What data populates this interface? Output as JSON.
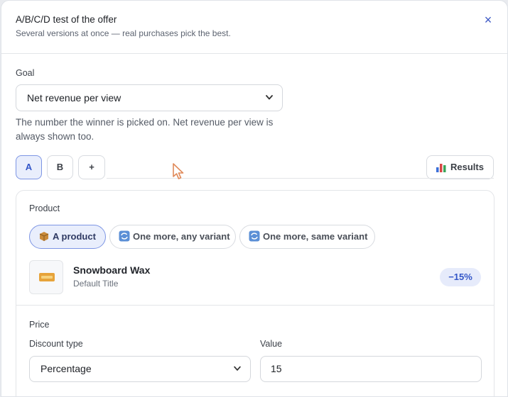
{
  "header": {
    "title": "A/B/C/D test of the offer",
    "subtitle": "Several versions at once — real purchases pick the best.",
    "close_glyph": "×"
  },
  "goal": {
    "label": "Goal",
    "selected": "Net revenue per view",
    "help": "The number the winner is picked on. Net revenue per view is always shown too."
  },
  "variants": {
    "tabs": [
      {
        "label": "A",
        "active": true
      },
      {
        "label": "B",
        "active": false
      },
      {
        "label": "+",
        "active": false
      }
    ],
    "results_label": "Results"
  },
  "product": {
    "section_label": "Product",
    "chips": [
      {
        "label": "A product",
        "icon": "package-icon",
        "active": true
      },
      {
        "label": "One more, any variant",
        "icon": "repeat-icon",
        "active": false
      },
      {
        "label": "One more, same variant",
        "icon": "repeat-icon",
        "active": false
      }
    ],
    "name": "Snowboard Wax",
    "variant": "Default Title",
    "discount_badge": "−15%"
  },
  "price": {
    "section_label": "Price",
    "discount_type_label": "Discount type",
    "discount_type_value": "Percentage",
    "value_label": "Value",
    "value": "15"
  },
  "colors": {
    "accent": "#3356c8",
    "accent_bg": "#e9eefc",
    "border": "#d8dbe0"
  }
}
